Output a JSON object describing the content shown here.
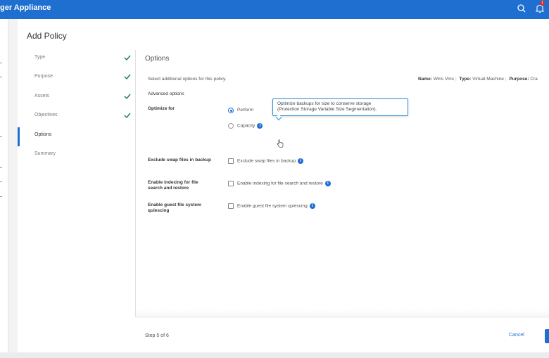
{
  "app": {
    "title": "ger Appliance"
  },
  "header": {
    "search_icon": "search-icon",
    "bell_icon": "bell-icon",
    "notification_count": "1"
  },
  "dialog": {
    "title": "Add Policy"
  },
  "steps": [
    {
      "label": "Type",
      "complete": true
    },
    {
      "label": "Purpose",
      "complete": true
    },
    {
      "label": "Assets",
      "complete": true
    },
    {
      "label": "Objectives",
      "complete": true
    },
    {
      "label": "Options",
      "complete": false,
      "active": true
    },
    {
      "label": "Summary",
      "complete": false
    }
  ],
  "content": {
    "section_title": "Options",
    "intro": "Select additional options for this policy.",
    "meta": {
      "name_label": "Name:",
      "name_value": "Wins Vms",
      "type_label": "Type:",
      "type_value": "Virtual Machine",
      "purpose_label": "Purpose:",
      "purpose_value": "Cra"
    },
    "advanced_title": "Advanced options",
    "optimize": {
      "label": "Optimize for",
      "option_performance": "Perform",
      "option_capacity": "Capacity",
      "selected": "performance"
    },
    "tooltip": {
      "line1": "Optimize backups for size to conserve storage",
      "line2": "(Protection Storage Variable Size Segmentation)."
    },
    "swap": {
      "label": "Exclude swap files in backup",
      "checkbox_text": "Exclude swap files in backup",
      "checked": false
    },
    "indexing": {
      "label": "Enable indexing for file search and restore",
      "checkbox_text": "Enable indexing for file search and restore",
      "checked": false
    },
    "quiescing": {
      "label": "Enable guest file system quiescing",
      "checkbox_text": "Enable guest file system quiescing",
      "checked": false
    },
    "info_glyph": "i"
  },
  "footer": {
    "step_count": "Step 5 of 6",
    "cancel": "Cancel"
  },
  "colors": {
    "accent": "#1f6fd1",
    "check": "#1a7a4a",
    "topbar": "#1f6fd1"
  }
}
